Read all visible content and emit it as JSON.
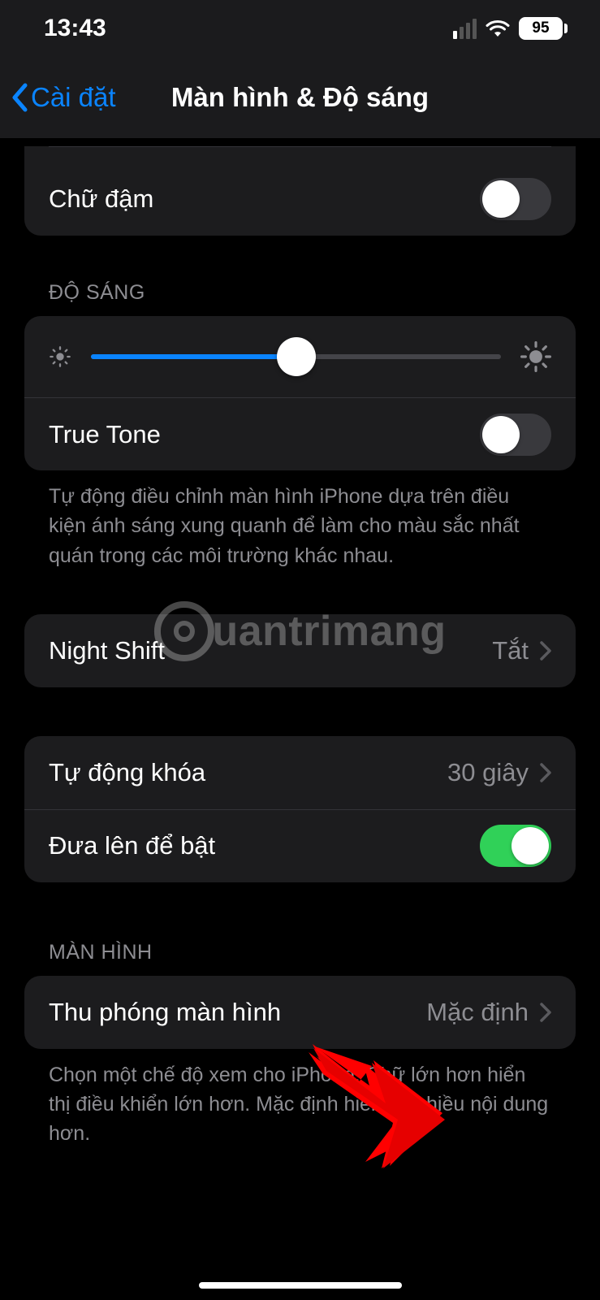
{
  "status": {
    "time": "13:43",
    "battery_percent": "95",
    "signal_active_bars": 1
  },
  "nav": {
    "back_label": "Cài đặt",
    "title": "Màn hình & Độ sáng"
  },
  "bold_text": {
    "label": "Chữ đậm",
    "on": false
  },
  "brightness": {
    "section_label": "ĐỘ SÁNG",
    "value_percent": 50,
    "true_tone_label": "True Tone",
    "true_tone_on": false,
    "footer": "Tự động điều chỉnh màn hình iPhone dựa trên điều kiện ánh sáng xung quanh để làm cho màu sắc nhất quán trong các môi trường khác nhau."
  },
  "night_shift": {
    "label": "Night Shift",
    "value": "Tắt"
  },
  "auto_lock": {
    "label": "Tự động khóa",
    "value": "30 giây"
  },
  "raise_to_wake": {
    "label": "Đưa lên để bật",
    "on": true
  },
  "display_zoom": {
    "section_label": "MÀN HÌNH",
    "label": "Thu phóng màn hình",
    "value": "Mặc định",
    "footer": "Chọn một chế độ xem cho iPhone. Chữ lớn hơn hiển thị điều khiển lớn hơn. Mặc định hiển thị nhiều nội dung hơn."
  },
  "watermark_text": "uantrimang"
}
